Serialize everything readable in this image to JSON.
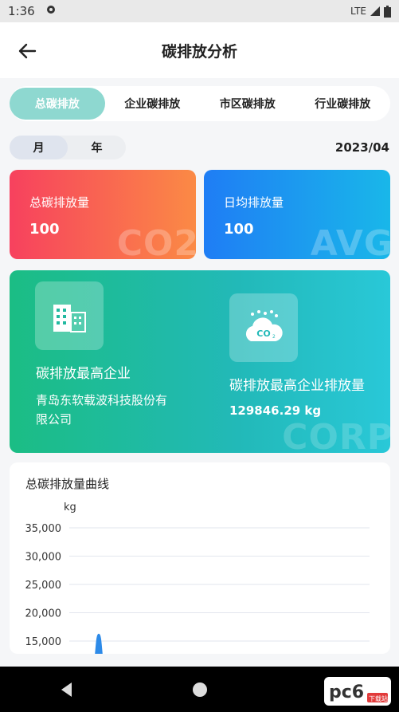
{
  "status": {
    "time": "1:36",
    "network": "LTE"
  },
  "header": {
    "title": "碳排放分析"
  },
  "tabs": [
    {
      "label": "总碳排放"
    },
    {
      "label": "企业碳排放"
    },
    {
      "label": "市区碳排放"
    },
    {
      "label": "行业碳排放"
    }
  ],
  "period": {
    "month": "月",
    "year": "年",
    "date": "2023/04"
  },
  "cards": {
    "total": {
      "label": "总碳排放量",
      "value": "100",
      "watermark": "CO2"
    },
    "avg": {
      "label": "日均排放量",
      "value": "100",
      "watermark": "AVG"
    }
  },
  "top_company": {
    "label": "碳排放最高企业",
    "name_line1": "青岛东软载波科技股份有",
    "name_line2": "限公司",
    "emission_label": "碳排放最高企业排放量",
    "emission_value": "129846.29 kg",
    "watermark": "CORP"
  },
  "chart": {
    "title": "总碳排放量曲线"
  },
  "chart_data": {
    "type": "line",
    "ylabel": "kg",
    "yticks": [
      "35,000",
      "30,000",
      "25,000",
      "20,000",
      "15,000"
    ],
    "ylim": [
      15000,
      35000
    ],
    "x": [
      0,
      1,
      2
    ],
    "values": [
      13000,
      16200,
      13000
    ],
    "color": "#2d8ae8",
    "grid": true
  },
  "brand": {
    "text": "pc6",
    "sub": "下载站"
  }
}
